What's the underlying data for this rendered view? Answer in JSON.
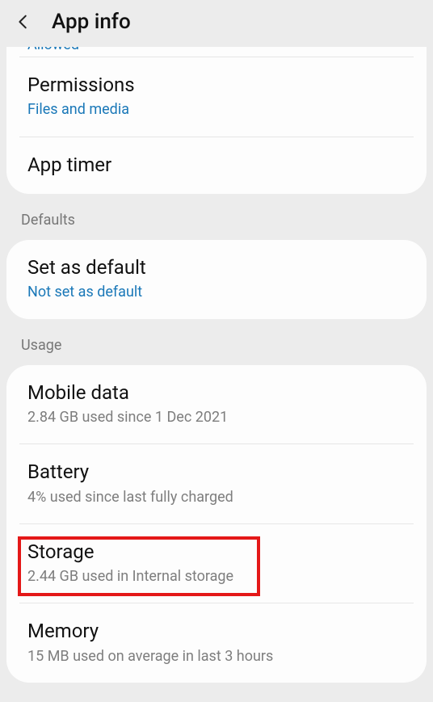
{
  "header": {
    "title": "App info"
  },
  "peek": {
    "label": "Allowed"
  },
  "settings1": {
    "permissions": {
      "title": "Permissions",
      "sub": "Files and media"
    },
    "app_timer": {
      "title": "App timer"
    }
  },
  "section_defaults": "Defaults",
  "defaults": {
    "set_default": {
      "title": "Set as default",
      "sub": "Not set as default"
    }
  },
  "section_usage": "Usage",
  "usage": {
    "mobile": {
      "title": "Mobile data",
      "sub": "2.84 GB used since 1 Dec 2021"
    },
    "battery": {
      "title": "Battery",
      "sub": "4% used since last fully charged"
    },
    "storage": {
      "title": "Storage",
      "sub": "2.44 GB used in Internal storage"
    },
    "memory": {
      "title": "Memory",
      "sub": "15 MB used on average in last 3 hours"
    }
  }
}
